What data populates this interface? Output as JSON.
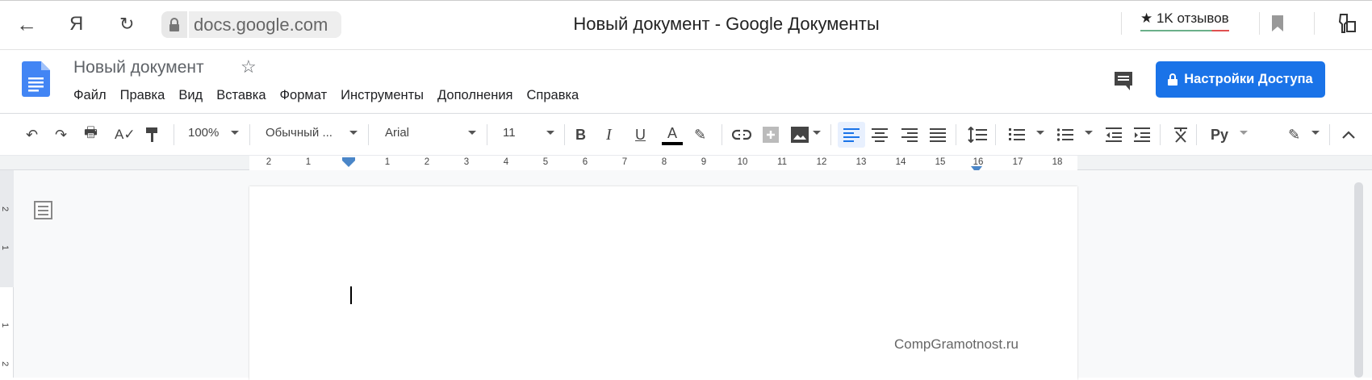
{
  "browser": {
    "url": "docs.google.com",
    "window_title": "Новый документ - Google Документы",
    "yandex_label": "Я",
    "reviews": "★ 1K отзывов",
    "icons": [
      "back-arrow-icon",
      "reload-icon",
      "lock-icon",
      "bookmark-icon",
      "extension-icon"
    ]
  },
  "docs": {
    "title": "Новый документ",
    "menu": [
      "Файл",
      "Правка",
      "Вид",
      "Вставка",
      "Формат",
      "Инструменты",
      "Дополнения",
      "Справка"
    ],
    "share_label": "Настройки Доступа",
    "accent": "#1a73e8"
  },
  "toolbar": {
    "zoom": "100%",
    "style": "Обычный ...",
    "font": "Arial",
    "size": "11",
    "bold": "B",
    "italic": "I",
    "underline": "U",
    "text_color": "A",
    "input_tools": "Py"
  },
  "ruler": {
    "left": [
      "2",
      "1"
    ],
    "right": [
      "1",
      "2",
      "3",
      "4",
      "5",
      "6",
      "7",
      "8",
      "9",
      "10",
      "11",
      "12",
      "13",
      "14",
      "15",
      "16",
      "17",
      "18"
    ]
  },
  "vruler": [
    "2",
    "1",
    "1",
    "2"
  ],
  "document": {
    "watermark": "CompGramotnost.ru"
  }
}
